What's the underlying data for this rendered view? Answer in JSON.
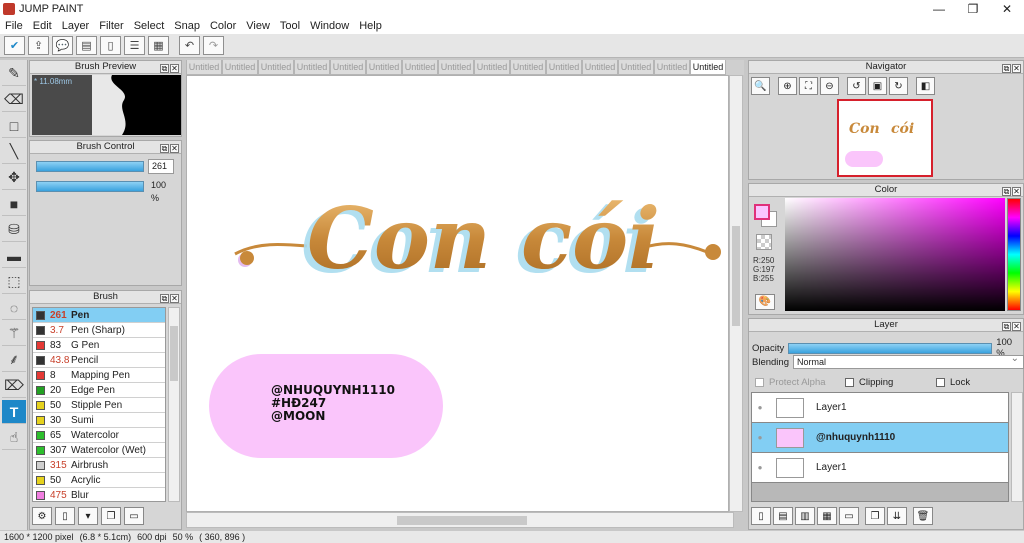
{
  "window": {
    "title": "JUMP PAINT",
    "controls": [
      "—",
      "❐",
      "✕"
    ]
  },
  "menu": [
    "File",
    "Edit",
    "Layer",
    "Filter",
    "Select",
    "Snap",
    "Color",
    "View",
    "Tool",
    "Window",
    "Help"
  ],
  "toolbar": {
    "icons": [
      "check-icon",
      "export-icon",
      "comment-icon",
      "speech-icon",
      "page-icon",
      "list-icon",
      "grid-icon"
    ],
    "undo": "↶",
    "redo": "↷"
  },
  "tools": [
    "pen-icon",
    "eraser-icon",
    "rect-icon",
    "line-icon",
    "move-icon",
    "fill-rect-icon",
    "bucket-icon",
    "gradient-icon",
    "select-rect-icon",
    "lasso-icon",
    "magic-wand-icon",
    "select-pen-icon",
    "select-eraser-icon",
    "text-icon",
    "pick-icon"
  ],
  "brush_preview": {
    "title": "Brush Preview",
    "size": "* 11.08mm"
  },
  "brush_control": {
    "title": "Brush Control",
    "size": "261",
    "opacity": "100 %"
  },
  "brush": {
    "title": "Brush",
    "items": [
      {
        "num": "261",
        "name": "Pen",
        "color": "#333333",
        "num_red": true,
        "selected": true
      },
      {
        "num": "3.7",
        "name": "Pen (Sharp)",
        "color": "#333333",
        "num_red": true
      },
      {
        "num": "83",
        "name": "G Pen",
        "color": "#e53935",
        "num_red": false
      },
      {
        "num": "43.8",
        "name": "Pencil",
        "color": "#333333",
        "num_red": true
      },
      {
        "num": "8",
        "name": "Mapping Pen",
        "color": "#e53935",
        "num_red": false
      },
      {
        "num": "20",
        "name": "Edge Pen",
        "color": "#22a022",
        "num_red": false
      },
      {
        "num": "50",
        "name": "Stipple Pen",
        "color": "#e6d21e",
        "num_red": false
      },
      {
        "num": "30",
        "name": "Sumi",
        "color": "#e6d21e",
        "num_red": false
      },
      {
        "num": "65",
        "name": "Watercolor",
        "color": "#2dbf2d",
        "num_red": false
      },
      {
        "num": "307",
        "name": "Watercolor (Wet)",
        "color": "#2dbf2d",
        "num_red": false
      },
      {
        "num": "315",
        "name": "Airbrush",
        "color": "#cfcfcf",
        "num_red": true
      },
      {
        "num": "50",
        "name": "Acrylic",
        "color": "#e6d21e",
        "num_red": false
      },
      {
        "num": "475",
        "name": "Blur",
        "color": "#f07ee0",
        "num_red": true
      }
    ]
  },
  "tabs": [
    "Untitled",
    "Untitled",
    "Untitled",
    "Untitled",
    "Untitled",
    "Untitled",
    "Untitled",
    "Untitled",
    "Untitled",
    "Untitled",
    "Untitled",
    "Untitled",
    "Untitled",
    "Untitled",
    "Untitled"
  ],
  "canvas": {
    "lettering_left": "Con",
    "lettering_right": "cói",
    "bubble_lines": [
      "@NHUQUYNH1110",
      "#HĐ247",
      "@MOON"
    ],
    "bubble_color": "#fac5fb"
  },
  "status": {
    "size": "1600 * 1200 pixel",
    "dims": "(6.8 * 5.1cm)",
    "dpi": "600 dpi",
    "zoom": "50 %",
    "coords": "( 360, 896 )"
  },
  "navigator": {
    "title": "Navigator"
  },
  "color": {
    "title": "Color",
    "r": "R:250",
    "g": "G:197",
    "b": "B:255",
    "fg": "#fac5ff"
  },
  "layer": {
    "title": "Layer",
    "opacity_label": "Opacity",
    "opacity_value": "100 %",
    "blending_label": "Blending",
    "blending_value": "Normal",
    "protect_alpha": "Protect Alpha",
    "clipping": "Clipping",
    "lock": "Lock",
    "layers": [
      {
        "name": "Layer1",
        "selected": false
      },
      {
        "name": "@nhuquynh1110",
        "selected": true
      },
      {
        "name": "Layer1",
        "selected": false
      }
    ]
  }
}
